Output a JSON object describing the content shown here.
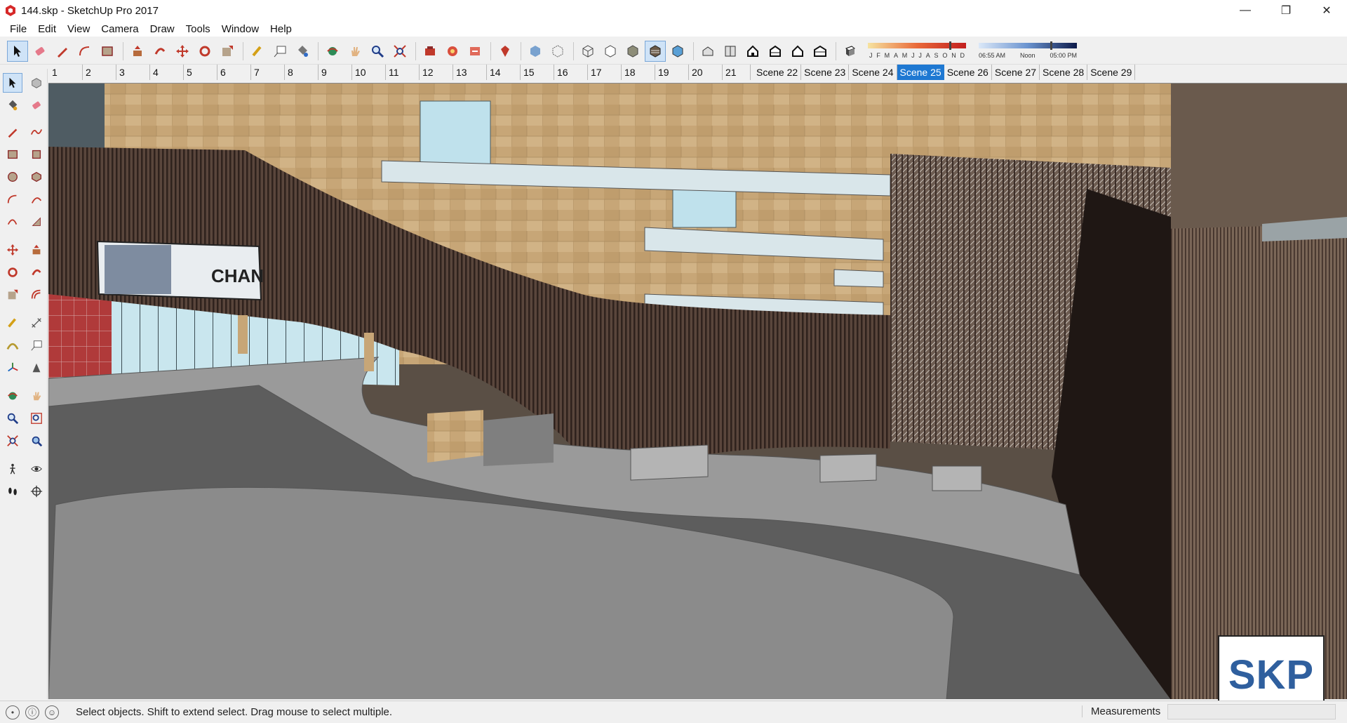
{
  "window": {
    "title": "144.skp - SketchUp Pro 2017"
  },
  "menu": [
    "File",
    "Edit",
    "View",
    "Camera",
    "Draw",
    "Tools",
    "Window",
    "Help"
  ],
  "shadow_panel": {
    "months": [
      "J",
      "F",
      "M",
      "A",
      "M",
      "J",
      "J",
      "A",
      "S",
      "O",
      "N",
      "D"
    ],
    "time_start": "06:55 AM",
    "time_mid": "Noon",
    "time_end": "05:00 PM"
  },
  "scenes": {
    "numbered": [
      "1",
      "2",
      "3",
      "4",
      "5",
      "6",
      "7",
      "8",
      "9",
      "10",
      "11",
      "12",
      "13",
      "14",
      "15",
      "16",
      "17",
      "18",
      "19",
      "20",
      "21"
    ],
    "named": [
      "Scene 22",
      "Scene 23",
      "Scene 24",
      "Scene 25",
      "Scene 26",
      "Scene 27",
      "Scene 28",
      "Scene 29"
    ],
    "active": "Scene 25"
  },
  "viewport": {
    "billboard_text": "CHAN",
    "logo_text": "SKP"
  },
  "status": {
    "hint": "Select objects. Shift to extend select. Drag mouse to select multiple.",
    "measurements_label": "Measurements"
  },
  "colors": {
    "accent": "#1e78d2",
    "facade_tan": "#c9a879",
    "louver_brown": "#4a3a33",
    "road": "#5a5a5a"
  }
}
